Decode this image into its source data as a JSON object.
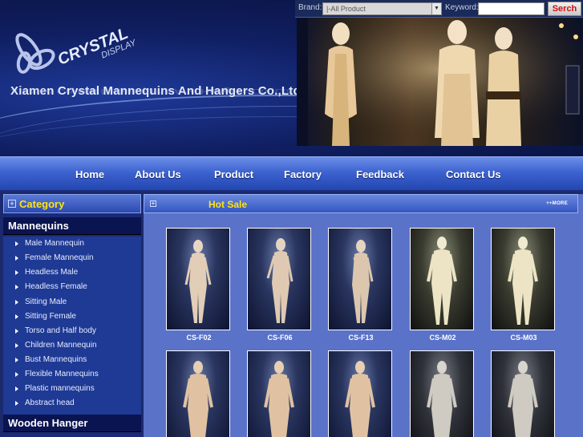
{
  "search": {
    "brand_label": "Brand:",
    "brand_value": "|-All Product",
    "keyword_label": "Keyword:",
    "keyword_value": "",
    "search_button": "Serch"
  },
  "header": {
    "company_name": "Xiamen Crystal Mannequins And Hangers Co.,Ltd",
    "logo_text_main": "CRYSTAL",
    "logo_text_sub": "DISPLAY"
  },
  "nav": {
    "items": [
      "Home",
      "About Us",
      "Product",
      "Factory",
      "Feedback",
      "Contact Us"
    ]
  },
  "sidebar": {
    "category_title": "Category",
    "mannequins_title": "Mannequins",
    "items": [
      "Male Mannequin",
      "Female Mannequin",
      "Headless Male",
      "Headless Female",
      "Sitting Male",
      "Sitting Female",
      "Torso and Half body",
      "Children Mannequin",
      "Bust Mannequins",
      "Flexible Mannequins",
      "Plastic mannequins",
      "Abstract head"
    ],
    "wooden_title": "Wooden Hanger"
  },
  "hot_sale": {
    "title": "Hot Sale",
    "more": "++MORE",
    "products_row1": [
      "CS-F02",
      "CS-F06",
      "CS-F13",
      "CS-M02",
      "CS-M03"
    ],
    "products_row2": [
      "",
      "",
      "",
      "",
      ""
    ]
  },
  "colors": {
    "accent_yellow": "#ffe414",
    "nav_blue": "#3d63d0",
    "search_red": "#d21010"
  }
}
